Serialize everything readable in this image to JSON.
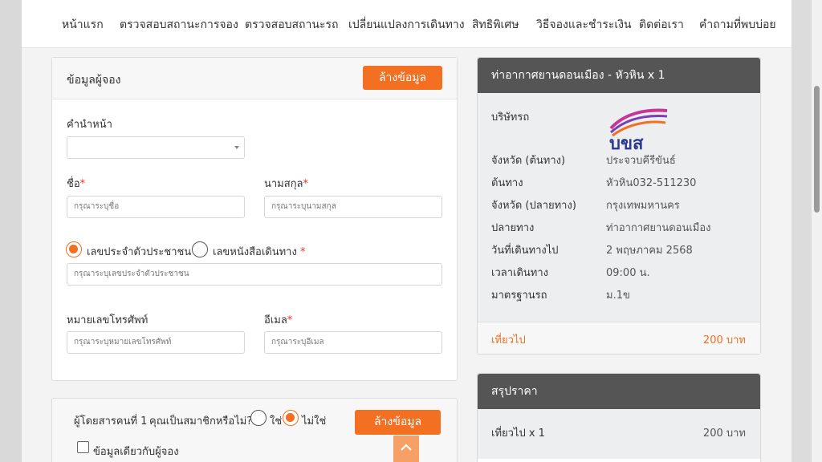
{
  "nav": {
    "items": [
      "หน้าแรก",
      "ตรวจสอบสถานะการจอง",
      "ตรวจสอบสถานะรถ",
      "เปลี่ยนแปลงการเดินทาง",
      "สิทธิพิเศษ",
      "วิธีจองและชำระเงิน",
      "ติดต่อเรา",
      "คำถามที่พบบ่อย"
    ]
  },
  "booker": {
    "title": "ข้อมูลผู้จอง",
    "clear_label": "ล้างข้อมูล",
    "prefix_label": "คำนำหน้า",
    "prefix_value": "",
    "firstname_label": "ชื่อ",
    "firstname_placeholder": "กรุณาระบุชื่อ",
    "lastname_label": "นามสกุล",
    "lastname_placeholder": "กรุณาระบุนามสกุล",
    "id_card_label": "เลขประจำตัวประชาชน",
    "passport_label": "เลขหนังสือเดินทาง",
    "required_mark": "*",
    "id_placeholder": "กรุณาระบุเลขประจำตัวประชาชน",
    "phone_label": "หมายเลขโทรศัพท์",
    "phone_placeholder": "กรุณาระบุหมายเลขโทรศัพท์",
    "email_label": "อีเมล",
    "email_placeholder": "กรุณาระบุอีเมล"
  },
  "passenger": {
    "title": "ผู้โดยสารคนที่ 1",
    "member_question": "คุณเป็นสมาชิกหรือไม่?",
    "yes_label": "ใช่",
    "no_label": "ไม่ใช่",
    "clear_label": "ล้างข้อมูล",
    "same_as_booker_label": "ข้อมูลเดียวกับผู้จอง"
  },
  "trip": {
    "title": "ท่าอากาศยานดอนเมือง - หัวหิน x 1",
    "company_label": "บริษัทรถ",
    "company_logo_text": "บขส",
    "rows": [
      {
        "k": "จังหวัด (ต้นทาง)",
        "v": "ประจวบคีรีขันธ์"
      },
      {
        "k": "ต้นทาง",
        "v": "หัวหิน032-511230"
      },
      {
        "k": "จังหวัด (ปลายทาง)",
        "v": "กรุงเทพมหานคร"
      },
      {
        "k": "ปลายทาง",
        "v": "ท่าอากาศยานดอนเมือง"
      },
      {
        "k": "วันที่เดินทางไป",
        "v": "2 พฤษภาคม 2568"
      },
      {
        "k": "เวลาเดินทาง",
        "v": "09:00 น."
      },
      {
        "k": "มาตรฐานรถ",
        "v": "ม.1ข"
      }
    ],
    "outbound_label": "เที่ยวไป",
    "outbound_price": "200 บาท"
  },
  "summary": {
    "title": "สรุปราคา",
    "line_label": "เที่ยวไป x 1",
    "line_price": "200 บาท"
  },
  "colors": {
    "accent": "#f36f21",
    "dark_header": "#555555",
    "logo_blue": "#2b3a8c"
  }
}
